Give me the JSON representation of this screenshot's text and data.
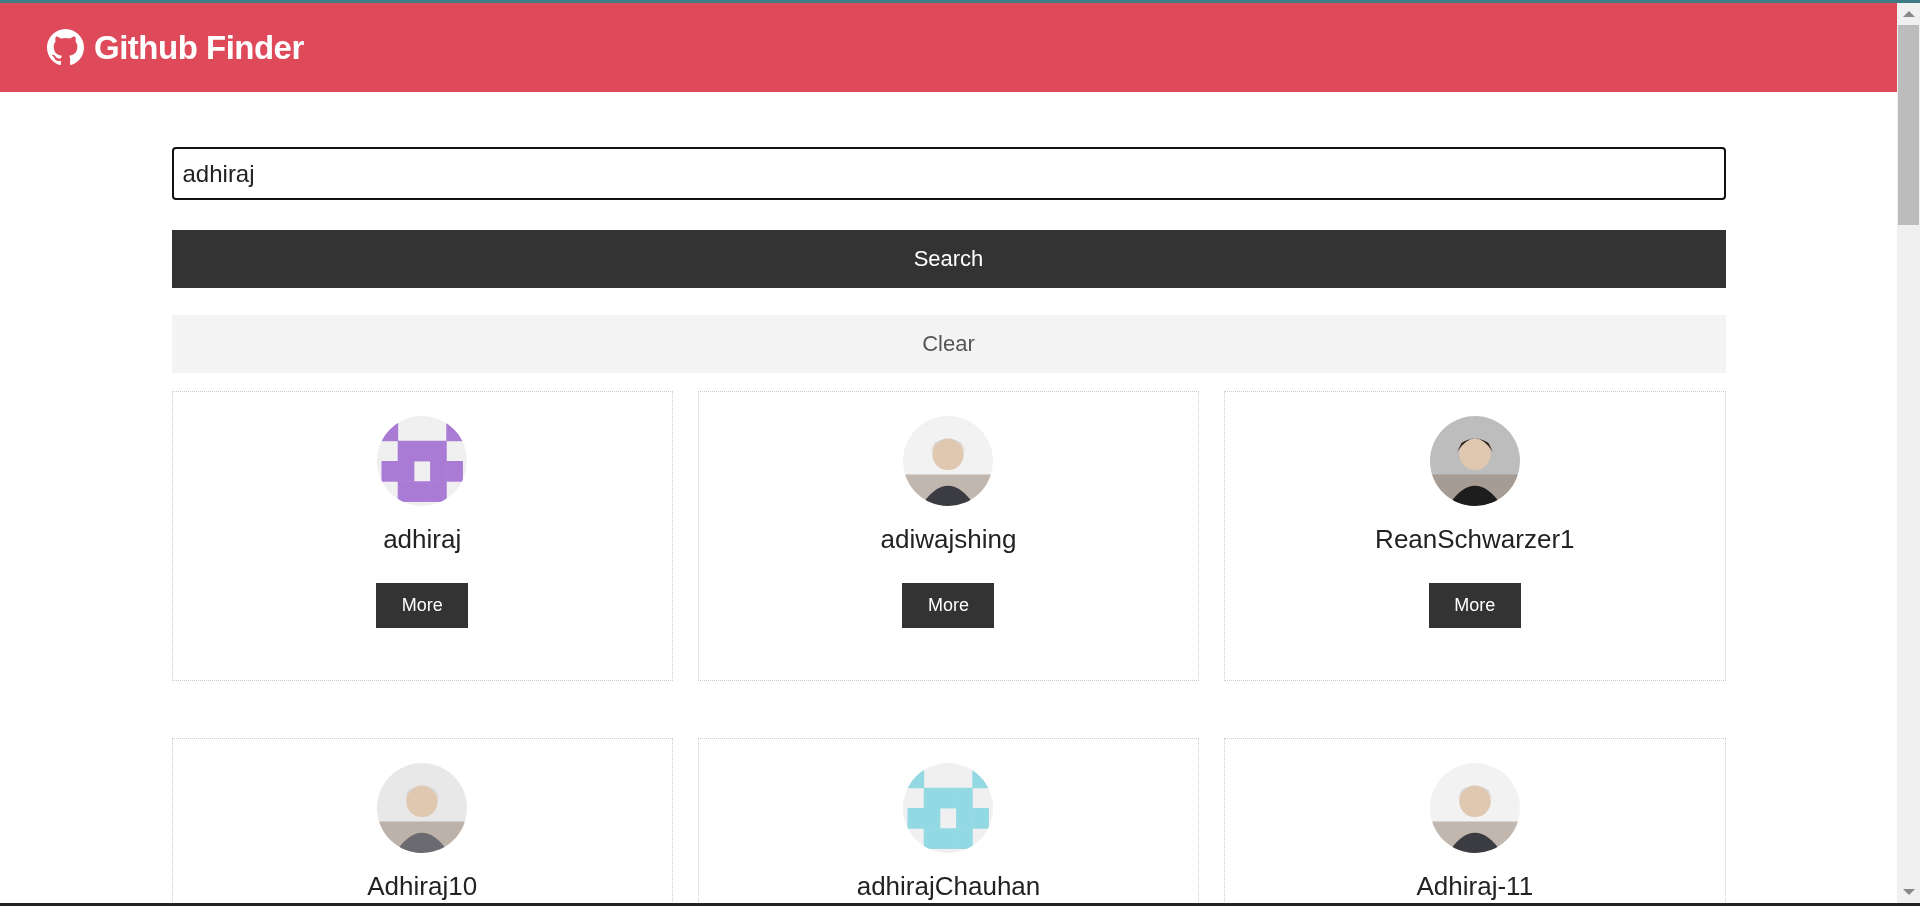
{
  "navbar": {
    "title": "Github Finder"
  },
  "search": {
    "value": "adhiraj"
  },
  "buttons": {
    "search": "Search",
    "clear": "Clear"
  },
  "users": [
    {
      "login": "adhiraj",
      "button": "More",
      "avatar": {
        "kind": "identicon",
        "color": "#a97bd4"
      }
    },
    {
      "login": "adiwajshing",
      "button": "More"
    },
    {
      "login": "ReanSchwarzer1",
      "button": "More"
    },
    {
      "login": "Adhiraj10"
    },
    {
      "login": "adhirajChauhan",
      "avatar": {
        "kind": "identicon",
        "color": "#92d9e3"
      }
    },
    {
      "login": "Adhiraj-11"
    }
  ]
}
